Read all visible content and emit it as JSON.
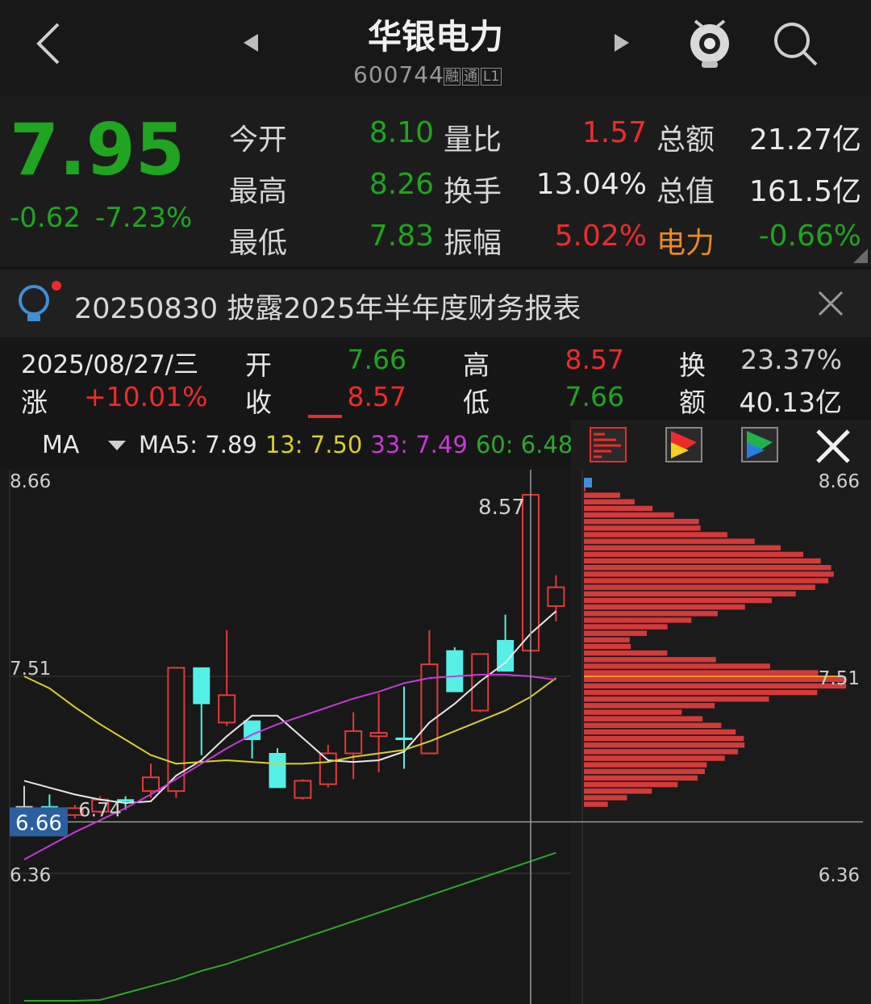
{
  "header": {
    "stock_name": "华银电力",
    "stock_code": "600744",
    "badges": [
      "融",
      "通",
      "L1"
    ],
    "icons": [
      "back-icon",
      "prev-stock-icon",
      "next-stock-icon",
      "mascot-icon",
      "search-icon"
    ]
  },
  "quote": {
    "price": "7.95",
    "change": "-0.62",
    "change_pct": "-7.23%",
    "rows": [
      [
        {
          "label": "今开",
          "value": "8.10"
        },
        {
          "label": "量比",
          "value": "1.57"
        },
        {
          "label": "总额",
          "value": "21.27亿"
        }
      ],
      [
        {
          "label": "最高",
          "value": "8.26"
        },
        {
          "label": "换手",
          "value": "13.04%"
        },
        {
          "label": "总值",
          "value": "161.5亿"
        }
      ],
      [
        {
          "label": "最低",
          "value": "7.83"
        },
        {
          "label": "振幅",
          "value": "5.02%"
        },
        {
          "label": "电力",
          "value": "-0.66%"
        }
      ]
    ],
    "colors": {
      "down": "#1fa51f",
      "up": "#ee2b2b",
      "sector_label": "#f08a1d"
    }
  },
  "notice": {
    "text": "20250830 披露2025年半年度财务报表",
    "icons": [
      "lightbulb-icon",
      "close-icon"
    ]
  },
  "day_info": {
    "date": "2025/08/27/三",
    "change_label": "涨",
    "change_pct": "+10.01%",
    "open_label": "开",
    "open": "7.66",
    "close_label": "收",
    "close": "8.57",
    "high_label": "高",
    "high": "8.57",
    "low_label": "低",
    "low": "7.66",
    "turnover_label": "换",
    "turnover": "23.37%",
    "amount_label": "额",
    "amount": "40.13亿"
  },
  "ma_bar": {
    "indicator": "MA",
    "ma5": "MA5: 7.89",
    "ma13": "13: 7.50",
    "ma33": "33: 7.49",
    "ma60": "60: 6.48",
    "more": "1",
    "icons": [
      "chip-distribution-icon",
      "red-flag-icon",
      "green-flag-icon",
      "close-icon"
    ]
  },
  "chart_data": {
    "type": "candlestick",
    "y_axis_labels": [
      "8.66",
      "7.51",
      "6.66",
      "6.36"
    ],
    "ylim": [
      6.36,
      8.66
    ],
    "annotations": [
      "8.57",
      "6.74"
    ],
    "cursor_price": "6.66",
    "candles": [
      {
        "o": 6.75,
        "c": 6.75,
        "h": 6.87,
        "l": 6.72
      },
      {
        "o": 6.75,
        "c": 6.73,
        "h": 6.82,
        "l": 6.67
      },
      {
        "o": 6.7,
        "c": 6.74,
        "h": 6.76,
        "l": 6.68
      },
      {
        "o": 6.72,
        "c": 6.79,
        "h": 6.81,
        "l": 6.71
      },
      {
        "o": 6.79,
        "c": 6.78,
        "h": 6.81,
        "l": 6.73
      },
      {
        "o": 6.84,
        "c": 6.92,
        "h": 7.0,
        "l": 6.8
      },
      {
        "o": 6.84,
        "c": 7.56,
        "h": 7.56,
        "l": 6.8
      },
      {
        "o": 7.56,
        "c": 7.35,
        "h": 7.56,
        "l": 7.05
      },
      {
        "o": 7.24,
        "c": 7.4,
        "h": 7.78,
        "l": 7.22
      },
      {
        "o": 7.25,
        "c": 7.14,
        "h": 7.25,
        "l": 7.03
      },
      {
        "o": 7.06,
        "c": 6.86,
        "h": 7.09,
        "l": 6.86
      },
      {
        "o": 6.8,
        "c": 6.9,
        "h": 6.91,
        "l": 6.79
      },
      {
        "o": 6.88,
        "c": 7.06,
        "h": 7.11,
        "l": 6.86
      },
      {
        "o": 7.06,
        "c": 7.19,
        "h": 7.3,
        "l": 6.91
      },
      {
        "o": 7.16,
        "c": 7.18,
        "h": 7.41,
        "l": 6.95
      },
      {
        "o": 7.15,
        "c": 7.14,
        "h": 7.45,
        "l": 6.97
      },
      {
        "o": 7.06,
        "c": 7.58,
        "h": 7.78,
        "l": 7.06
      },
      {
        "o": 7.66,
        "c": 7.42,
        "h": 7.68,
        "l": 7.42
      },
      {
        "o": 7.31,
        "c": 7.64,
        "h": 7.64,
        "l": 7.3
      },
      {
        "o": 7.72,
        "c": 7.54,
        "h": 7.87,
        "l": 7.54
      },
      {
        "o": 7.66,
        "c": 8.57,
        "h": 8.57,
        "l": 7.66
      },
      {
        "o": 7.92,
        "c": 8.03,
        "h": 8.1,
        "l": 7.83
      }
    ],
    "ma_series": [
      {
        "name": "MA5",
        "color": "#e8e8e8",
        "values": [
          6.9,
          6.86,
          6.82,
          6.79,
          6.77,
          6.78,
          6.93,
          7.02,
          7.16,
          7.28,
          7.28,
          7.15,
          7.02,
          7.01,
          7.02,
          7.07,
          7.24,
          7.35,
          7.48,
          7.59,
          7.76,
          7.89
        ]
      },
      {
        "name": "13",
        "color": "#d9cf2a",
        "values": [
          7.51,
          7.44,
          7.33,
          7.23,
          7.14,
          7.05,
          7.0,
          7.01,
          7.02,
          7.01,
          7.0,
          7.0,
          7.01,
          7.04,
          7.06,
          7.08,
          7.13,
          7.19,
          7.25,
          7.31,
          7.39,
          7.5
        ]
      },
      {
        "name": "33",
        "color": "#c63ad8",
        "values": [
          6.44,
          6.52,
          6.6,
          6.67,
          6.74,
          6.82,
          6.91,
          7.0,
          7.09,
          7.17,
          7.23,
          7.28,
          7.33,
          7.38,
          7.42,
          7.47,
          7.5,
          7.51,
          7.52,
          7.52,
          7.51,
          7.49
        ]
      },
      {
        "name": "60",
        "color": "#2ea62e",
        "values": [
          5.52,
          5.55,
          5.58,
          5.62,
          5.66,
          5.7,
          5.74,
          5.79,
          5.83,
          5.88,
          5.93,
          5.98,
          6.03,
          6.08,
          6.13,
          6.18,
          6.23,
          6.28,
          6.33,
          6.38,
          6.43,
          6.48
        ]
      }
    ],
    "volume_profile_ylim": [
      6.36,
      8.66
    ]
  }
}
